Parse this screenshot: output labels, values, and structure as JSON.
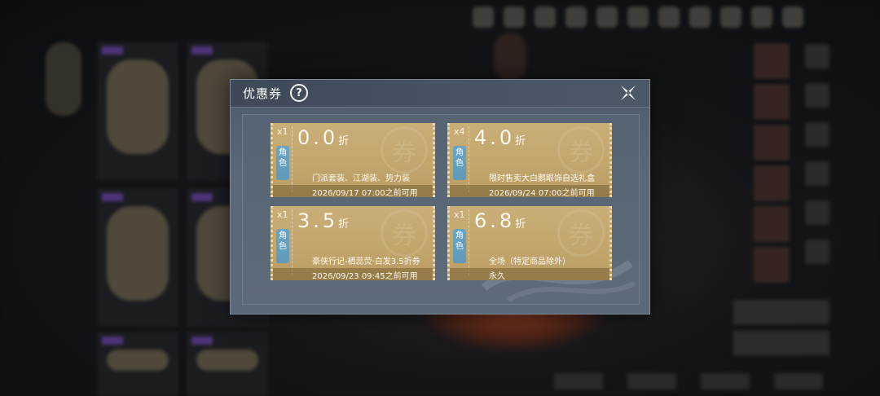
{
  "dialog": {
    "title": "优惠券",
    "help_label": "?"
  },
  "coupons": [
    {
      "quantity": "x1",
      "discount": "0.0",
      "unit": "折",
      "role_tag": "角色",
      "description": "门派套装、江湖装、势力装",
      "expiry": "2026/09/17 07:00之前可用"
    },
    {
      "quantity": "x4",
      "discount": "4.0",
      "unit": "折",
      "role_tag": "角色",
      "description": "限时售卖大白鹅眼饰自选礼盒",
      "expiry": "2026/09/24 07:00之前可用"
    },
    {
      "quantity": "x1",
      "discount": "3.5",
      "unit": "折",
      "role_tag": "角色",
      "description": "豪侠行记-栖蕊荧·白发3.5折券",
      "expiry": "2026/09/23 09:45之前可用"
    },
    {
      "quantity": "x1",
      "discount": "6.8",
      "unit": "折",
      "role_tag": "角色",
      "description": "全场（特定商品除外）",
      "expiry": "永久"
    }
  ],
  "colors": {
    "coupon_gold": "#c2a56c",
    "role_tag_blue": "#6aa4c4",
    "dialog_slate": "#5a6878"
  }
}
